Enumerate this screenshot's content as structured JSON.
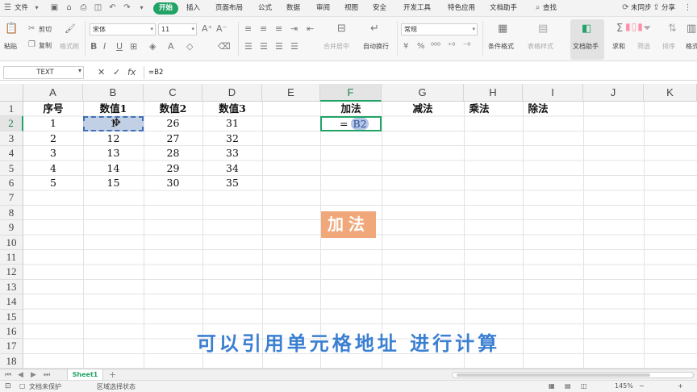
{
  "menubar": {
    "file": "文件",
    "tabs": [
      {
        "label": "开始",
        "active": true
      },
      {
        "label": "插入"
      },
      {
        "label": "页面布局"
      },
      {
        "label": "公式"
      },
      {
        "label": "数据"
      },
      {
        "label": "审阅"
      },
      {
        "label": "视图"
      },
      {
        "label": "安全"
      },
      {
        "label": "开发工具"
      },
      {
        "label": "特色应用"
      },
      {
        "label": "文档助手"
      }
    ],
    "search": "查找",
    "sync": "未同步",
    "share": "分享",
    "accent_color": "#21a366"
  },
  "ribbon": {
    "paste": "粘贴",
    "cut": "剪切",
    "copy": "复制",
    "format_painter": "格式刷",
    "font_name": "宋体",
    "font_size": "11",
    "merge_center": "合并居中",
    "wrap_text": "自动换行",
    "number_format": "常规",
    "conditional_format": "条件格式",
    "table_style": "表格样式",
    "doc_assistant": "文档助手",
    "sum": "求和",
    "filter": "筛选",
    "sort": "排序",
    "format": "格式"
  },
  "formula_bar": {
    "name_box": "TEXT",
    "fx": "fx",
    "formula": "=B2"
  },
  "columns": [
    "A",
    "B",
    "C",
    "D",
    "E",
    "F",
    "G",
    "H",
    "I",
    "J",
    "K"
  ],
  "rows": [
    "1",
    "2",
    "3",
    "4",
    "5",
    "6",
    "7",
    "8",
    "9",
    "10",
    "11",
    "12",
    "13",
    "14",
    "15",
    "16",
    "17",
    "18"
  ],
  "cells": {
    "A1": "序号",
    "B1": "数值1",
    "C1": "数值2",
    "D1": "数值3",
    "F1": "加法",
    "G1": "减法",
    "H1": "乘法",
    "I1": "除法",
    "A2": "1",
    "B2": "1",
    "C2": "26",
    "D2": "31",
    "A3": "2",
    "B3": "12",
    "C3": "27",
    "D3": "32",
    "A4": "3",
    "B4": "13",
    "C4": "28",
    "D4": "33",
    "A5": "4",
    "B5": "14",
    "C5": "29",
    "D5": "34",
    "A6": "5",
    "B6": "15",
    "C6": "30",
    "D6": "35"
  },
  "editing_cell": {
    "prefix": "=",
    "reference": "B2"
  },
  "overlay": {
    "badge": "加法",
    "badge_color": "#f0a77a",
    "subtitle": "可以引用单元格地址  进行计算",
    "subtitle_color": "#3b7fd1"
  },
  "sheet_tabs": [
    "Sheet1"
  ],
  "status": {
    "doc_state": "文档未保护",
    "mode": "区域选择状态",
    "zoom": "145%"
  }
}
